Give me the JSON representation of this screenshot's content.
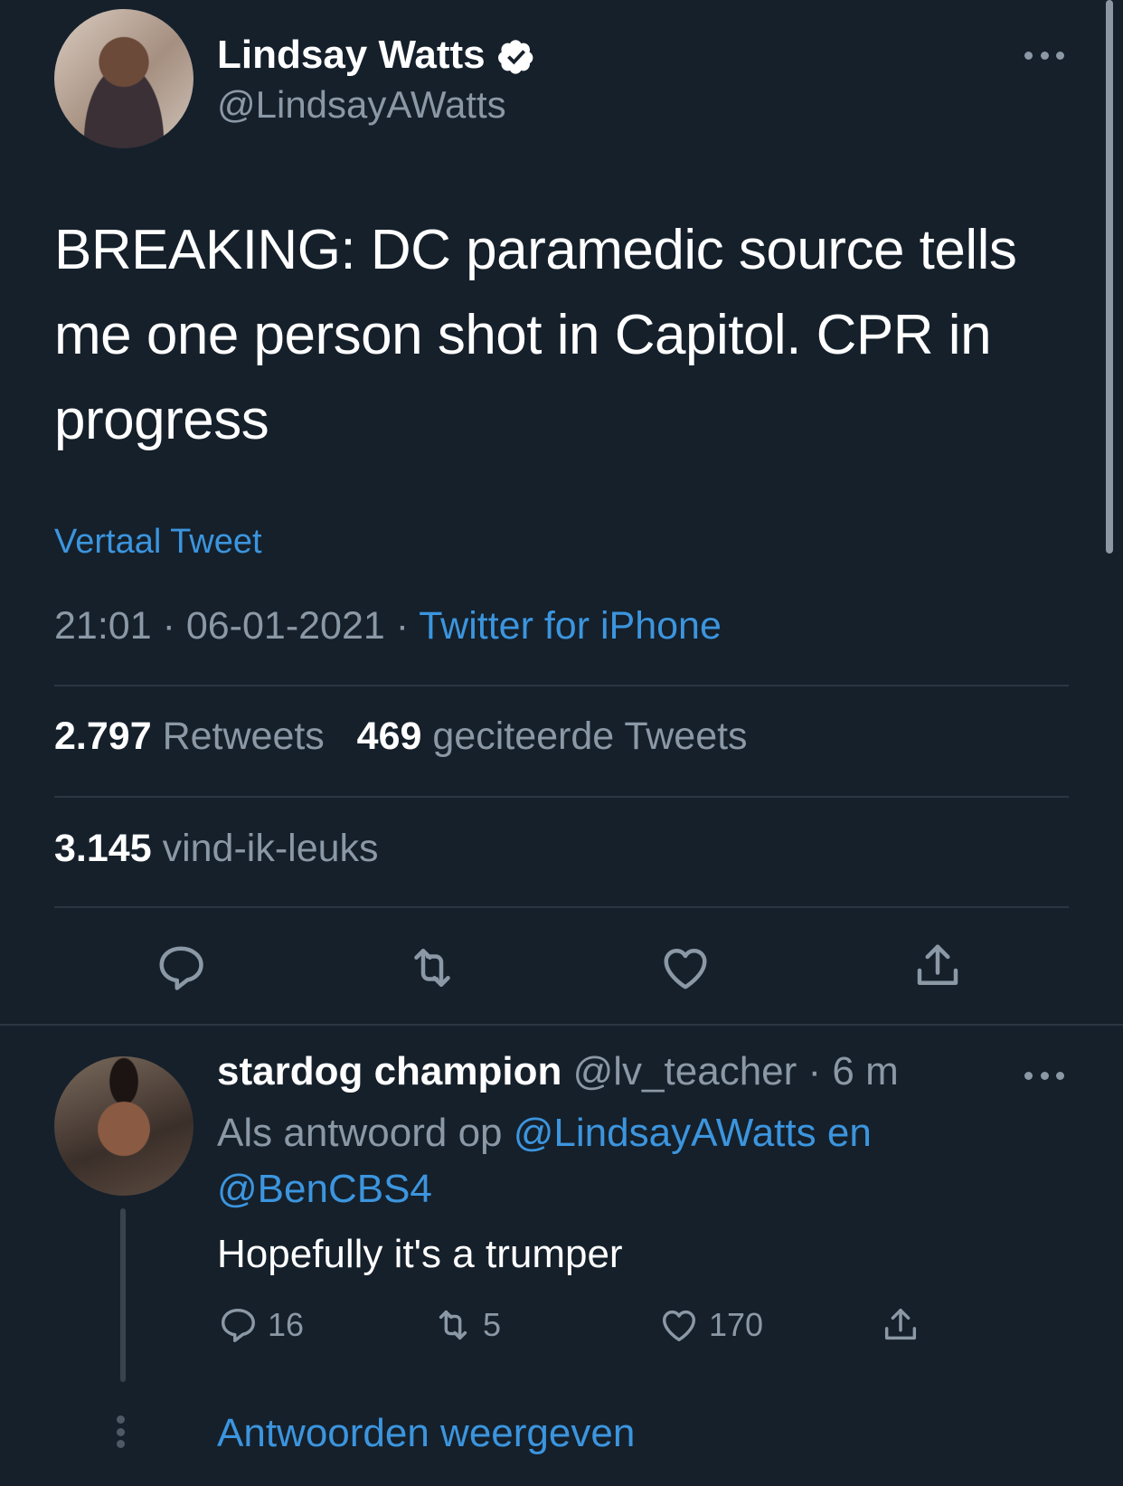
{
  "tweet": {
    "author": {
      "name": "Lindsay Watts",
      "handle": "@LindsayAWatts",
      "verified": true
    },
    "text": "BREAKING: DC paramedic source tells me one person shot in Capitol. CPR in progress",
    "translate_label": "Vertaal Tweet",
    "time": "21:01",
    "date": "06-01-2021",
    "separator": "·",
    "source": "Twitter for iPhone",
    "stats": {
      "retweets_count": "2.797",
      "retweets_label": "Retweets",
      "quotes_count": "469",
      "quotes_label": "geciteerde Tweets",
      "likes_count": "3.145",
      "likes_label": "vind-ik-leuks"
    }
  },
  "reply": {
    "author_name": "stardog champion",
    "handle": "@lv_teacher",
    "time_sep": "·",
    "time": "6 m",
    "reply_prefix": "Als antwoord op",
    "mention1": "@LindsayAWatts",
    "conjunction": "en",
    "mention2": "@BenCBS4",
    "text": "Hopefully it's a trumper",
    "replies": "16",
    "retweets": "5",
    "likes": "170"
  },
  "show_replies_label": "Antwoorden weergeven",
  "icons": {
    "reply": "speech-bubble-icon",
    "retweet": "retweet-arrows-icon",
    "like": "heart-icon",
    "share": "share-upload-icon",
    "verified": "verified-badge-icon",
    "more": "more-dots-icon"
  },
  "colors": {
    "background": "#15202b",
    "accent": "#3c95de",
    "muted": "#8b98a5"
  }
}
